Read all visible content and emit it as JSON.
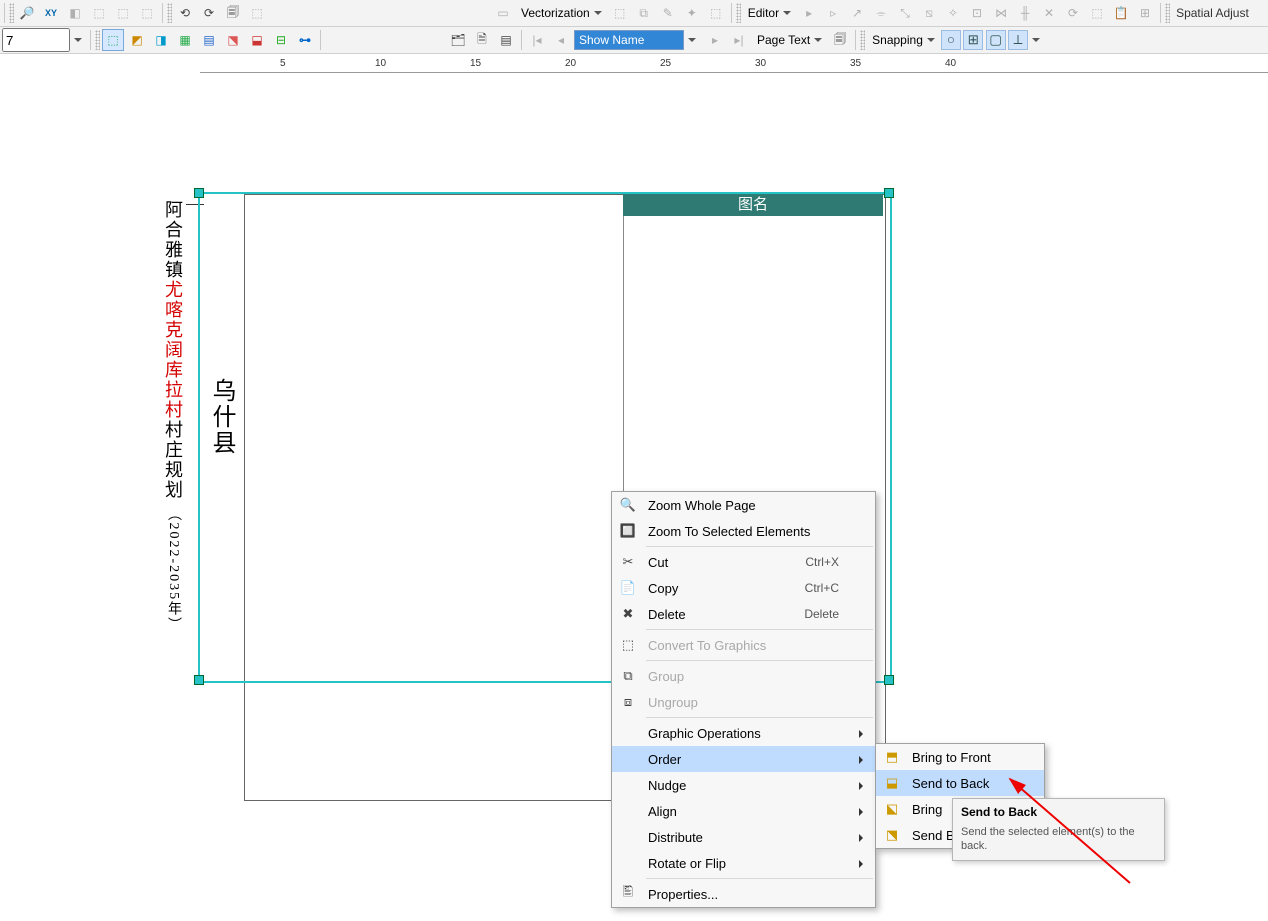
{
  "toolbar": {
    "num_field": "7",
    "vectorization": "Vectorization",
    "editor": "Editor",
    "spatial": "Spatial Adjust",
    "show_name": "Show Name",
    "page_text": "Page Text",
    "snapping": "Snapping"
  },
  "ruler": {
    "t5": "5",
    "t10": "10",
    "t15": "15",
    "t20": "20",
    "t25": "25",
    "t30": "30",
    "t35": "35",
    "t40": "40"
  },
  "doc": {
    "county": "乌什县",
    "town_pre": "阿合雅镇",
    "village_red": "尤喀克阔库拉村",
    "plan_suf": "村庄规划",
    "years": "（2022-2035年）",
    "legend_title": "图名"
  },
  "ctx": {
    "zoom_whole": "Zoom Whole Page",
    "zoom_sel": "Zoom To Selected Elements",
    "cut": "Cut",
    "cut_sc": "Ctrl+X",
    "copy": "Copy",
    "copy_sc": "Ctrl+C",
    "delete": "Delete",
    "delete_sc": "Delete",
    "convert": "Convert To Graphics",
    "group": "Group",
    "ungroup": "Ungroup",
    "gops": "Graphic Operations",
    "order": "Order",
    "nudge": "Nudge",
    "align": "Align",
    "distribute": "Distribute",
    "rotflip": "Rotate or Flip",
    "props": "Properties..."
  },
  "order_sub": {
    "bfront": "Bring to Front",
    "sback": "Send to Back",
    "bforward": "Bring",
    "sbackward": "Send B"
  },
  "tooltip": {
    "title": "Send to Back",
    "body": "Send the selected element(s) to the back."
  }
}
